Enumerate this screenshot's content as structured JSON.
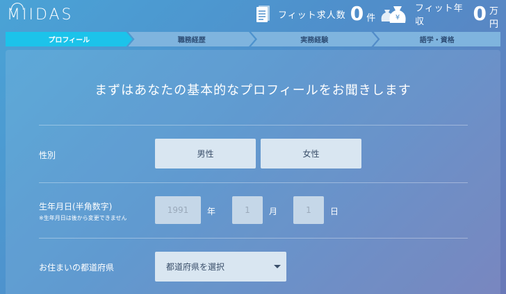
{
  "header": {
    "logo_text": "MIIDAS",
    "jobs": {
      "label": "フィット求人数",
      "value": "0",
      "unit": "件",
      "icon": "document-icon"
    },
    "salary": {
      "label": "フィット年収",
      "value": "0",
      "unit": "万円",
      "icon": "money-bag-icon"
    }
  },
  "steps": [
    {
      "label": "プロフィール",
      "active": true
    },
    {
      "label": "職務経歴",
      "active": false
    },
    {
      "label": "実務経験",
      "active": false
    },
    {
      "label": "語学・資格",
      "active": false
    }
  ],
  "form": {
    "title": "まずはあなたの基本的なプロフィールをお聞きします",
    "gender": {
      "label": "性別",
      "male": "男性",
      "female": "女性"
    },
    "birthdate": {
      "label": "生年月日(半角数字)",
      "note": "※生年月日は後から変更できません",
      "year_placeholder": "1991",
      "year_unit": "年",
      "month_placeholder": "1",
      "month_unit": "月",
      "day_placeholder": "1",
      "day_unit": "日"
    },
    "prefecture": {
      "label": "お住まいの都道府県",
      "placeholder": "都道府県を選択"
    }
  },
  "colors": {
    "active_step": "#1cc3ea",
    "inactive_step": "#7fb4de",
    "button_bg": "#d9e6f1"
  }
}
